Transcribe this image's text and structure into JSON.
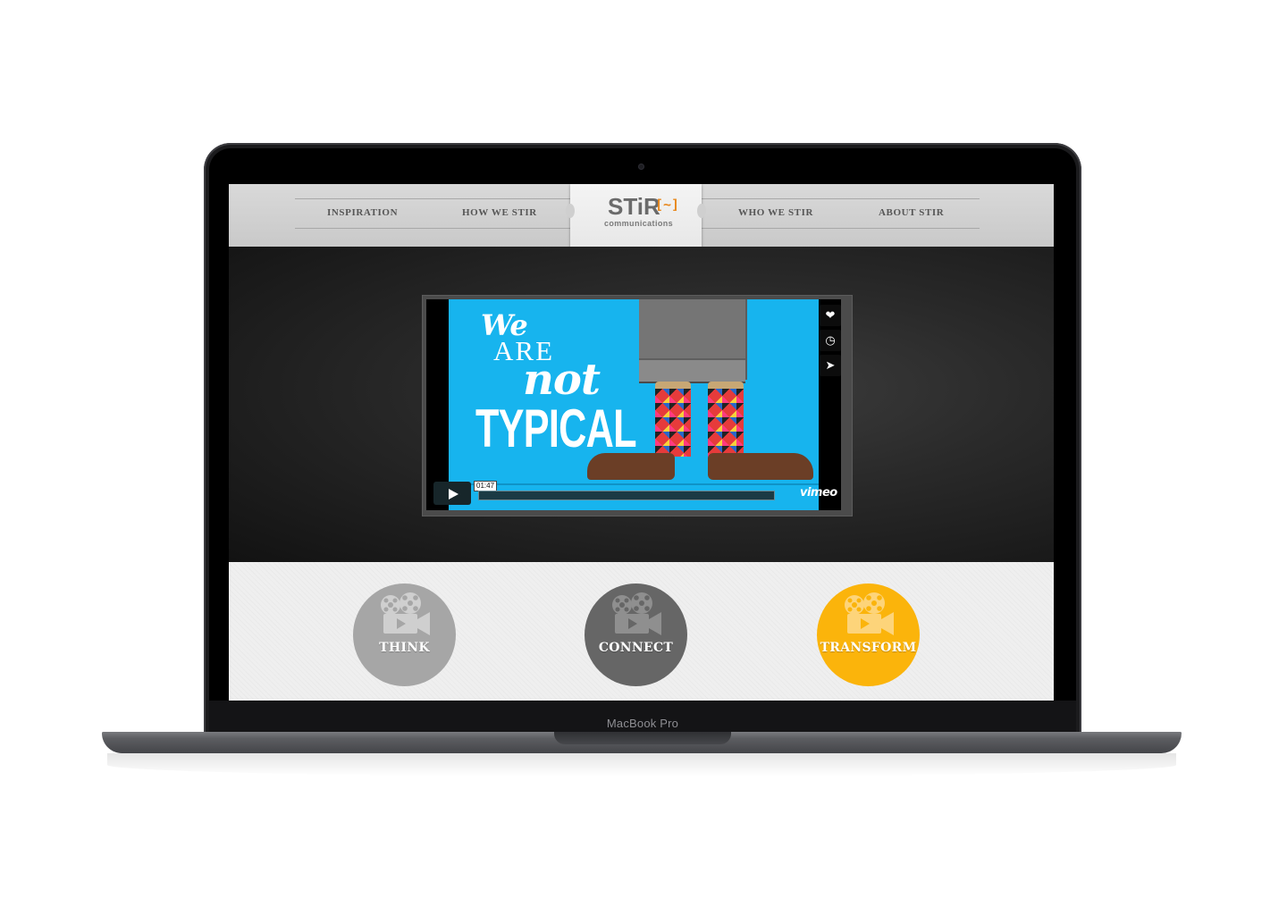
{
  "device": {
    "model_label": "MacBook Pro"
  },
  "nav": {
    "items": [
      {
        "label": "INSPIRATION"
      },
      {
        "label": "HOW WE STIR"
      },
      {
        "label": "WHO WE STIR"
      },
      {
        "label": "ABOUT STIR"
      }
    ]
  },
  "logo": {
    "word": "STiR",
    "bracket": "[~]",
    "sub": "communications"
  },
  "video": {
    "headline": {
      "line1": "We",
      "line2": "ARE",
      "line3": "not",
      "line4": "TYPICAL"
    },
    "time": "01:47",
    "brand": "vimeo",
    "side_icons": [
      "heart-icon",
      "clock-icon",
      "send-icon"
    ],
    "colors": {
      "background": "#17b4ee"
    }
  },
  "features": [
    {
      "label": "THINK",
      "color": "#a6a6a6",
      "icon": "film-camera-icon"
    },
    {
      "label": "CONNECT",
      "color": "#666666",
      "icon": "film-camera-icon"
    },
    {
      "label": "TRANSFORM",
      "color": "#fbb40b",
      "icon": "film-camera-icon"
    }
  ]
}
